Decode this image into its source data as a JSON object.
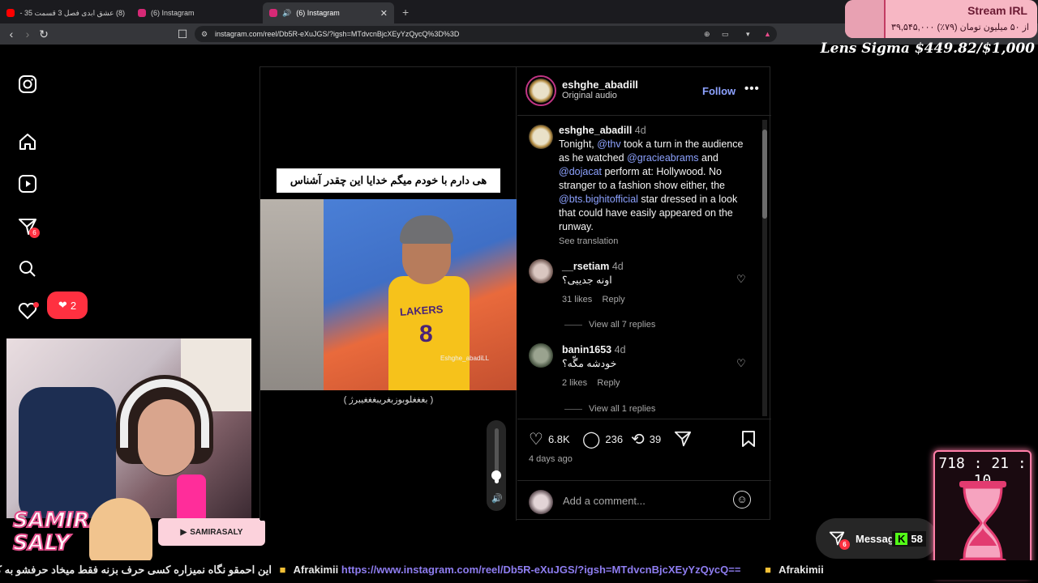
{
  "browser": {
    "tabs": [
      {
        "label": "(8) عشق ابدی فصل 3 قسمت 35 - ‪‪ube‬",
        "favicon": "youtube-icon",
        "color": "#ff0000"
      },
      {
        "label": "(6) Instagram",
        "favicon": "instagram-icon",
        "color": "#d62976"
      },
      {
        "label": "(6) Instagram",
        "favicon": "instagram-icon",
        "color": "#d62976",
        "active": true
      }
    ],
    "new_tab": "+",
    "url": "instagram.com/reel/Db5R-eXuJGS/?igsh=MTdvcnBjcXEyYzQycQ%3D%3D"
  },
  "overlay": {
    "stream_title": "Stream IRL",
    "stream_sub": "۳۹,۵۴۵,۰۰۰ از ۵۰ میلیون تومان (۷۹٪)",
    "lens": "Lens Sigma $449.82/$1,000",
    "brand_name_1": "SAMIRA",
    "brand_name_2": "SALY",
    "brand_handle": "SAMIRASALY",
    "timer": "718 : 21 : 10",
    "ticker_rtl": "این احمقو نگاه نمیزاره کسی حرف بزنه فقط میخاد حرفشو به کرسی بنشونه",
    "ticker_user1": "Afrakimii",
    "ticker_link": "https://www.instagram.com/reel/Db5R-eXuJGS/?igsh=MTdvcnBjcXEyYzQycQ==",
    "ticker_user2": "Afrakimii",
    "kick_count": "58"
  },
  "sidebar": {
    "messages_badge": "6",
    "notif_count": "2"
  },
  "video": {
    "caption": "هی دارم با خودم میگم خدایا این چقدر آشناس",
    "jersey_text": "LAKERS",
    "jersey_number": "8",
    "watermark": "Eshghe_abadiLL",
    "subtitle": "( بغغغلوبوزبغریبغغغیبرژ )"
  },
  "post": {
    "author": "eshghe_abadill",
    "audio": "Original audio",
    "follow": "Follow",
    "caption_user": "eshghe_abadill",
    "caption_time": "4d",
    "caption_p1": "Tonight, ",
    "caption_m1": "@thv",
    "caption_p2": " took a turn in the audience as he watched ",
    "caption_m2": "@gracieabrams",
    "caption_p3": " and ",
    "caption_m3": "@dojacat",
    "caption_p4": " perform at: Hollywood. No stranger to a fashion show either, the ",
    "caption_m4": "@bts.bighitofficial",
    "caption_p5": " star dressed in a look that could have easily appeared on the runway.",
    "see_translation": "See translation",
    "comments": [
      {
        "user": "__rsetiam",
        "time": "4d",
        "text": "اونه جدییی؟",
        "likes": "31 likes",
        "reply": "Reply",
        "view": "View all 7 replies"
      },
      {
        "user": "banin1653",
        "time": "4d",
        "text": "خودشه مگّه؟",
        "likes": "2 likes",
        "reply": "Reply",
        "view": "View all 1 replies"
      }
    ],
    "likes": "6.8K",
    "comment_count": "236",
    "reposts": "39",
    "ago": "4 days ago",
    "add_comment": "Add a comment...",
    "messages_label": "Messag",
    "messages_badge": "6"
  }
}
